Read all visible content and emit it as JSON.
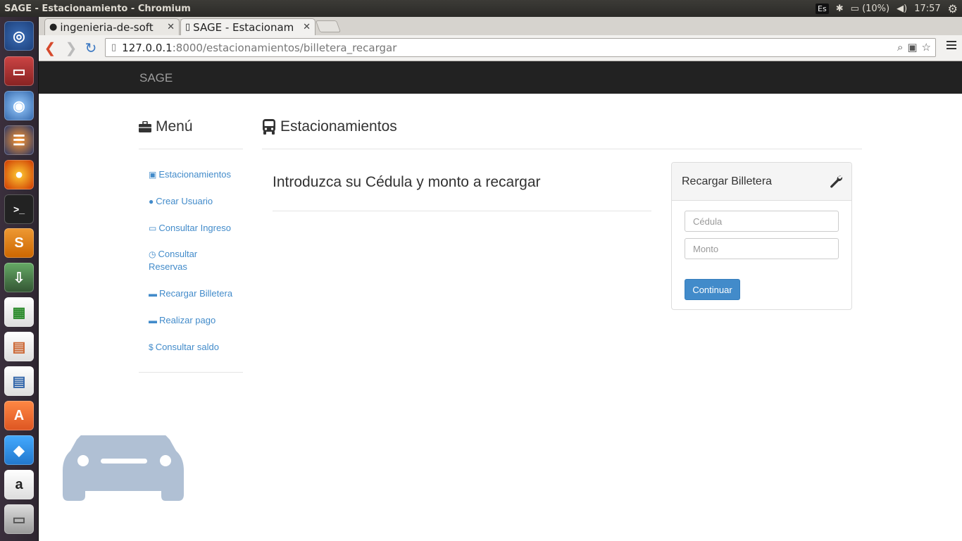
{
  "system_panel": {
    "window_title": "SAGE - Estacionamiento - Chromium",
    "keyboard_layout": "Es",
    "battery": "(10%)",
    "clock": "17:57"
  },
  "launcher": {
    "icons": [
      "ubuntu-dash-icon",
      "files-icon",
      "chromium-icon",
      "eclipse-icon",
      "firefox-icon",
      "terminal-icon",
      "sublime-text-icon",
      "installer-icon",
      "calc-icon",
      "impress-icon",
      "writer-icon",
      "software-center-icon",
      "dropbox-icon",
      "amazon-icon",
      "drive-icon"
    ]
  },
  "browser": {
    "tabs": [
      {
        "label": "ingenieria-de-soft",
        "active": false
      },
      {
        "label": "SAGE - Estacionam",
        "active": true
      }
    ],
    "url_host": "127.0.0.1",
    "url_path": ":8000/estacionamientos/billetera_recargar"
  },
  "navbar": {
    "brand": "SAGE"
  },
  "sidebar": {
    "title": "Menú",
    "items": [
      {
        "label": "Estacionamientos",
        "icon": "bus-icon"
      },
      {
        "label": "Crear Usuario",
        "icon": "user-icon"
      },
      {
        "label": "Consultar Ingreso",
        "icon": "money-icon"
      },
      {
        "label": "Consultar Reservas",
        "icon": "clock-icon"
      },
      {
        "label": "Recargar Billetera",
        "icon": "credit-card-icon"
      },
      {
        "label": "Realizar pago",
        "icon": "credit-card-icon"
      },
      {
        "label": "Consultar saldo",
        "icon": "dollar-icon"
      }
    ]
  },
  "main": {
    "title": "Estacionamientos",
    "heading": "Introduzca su Cédula y monto a recargar"
  },
  "panel": {
    "title": "Recargar Billetera",
    "cedula_placeholder": "Cédula",
    "monto_placeholder": "Monto",
    "submit_label": "Continuar"
  }
}
